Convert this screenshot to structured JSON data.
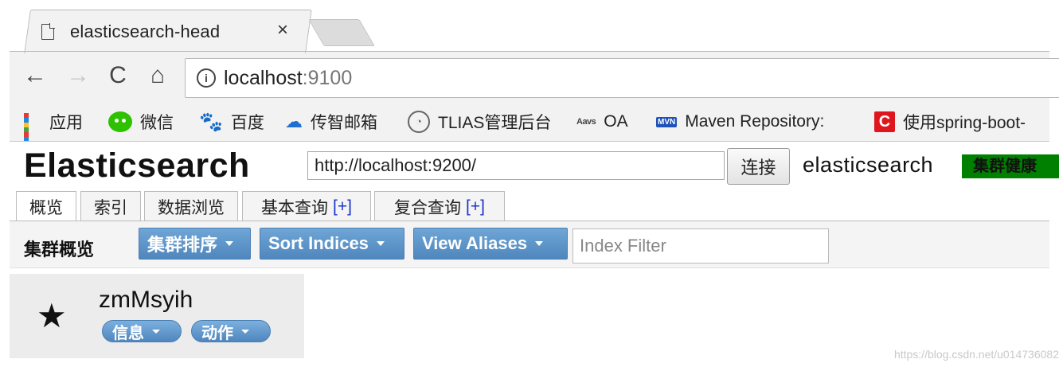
{
  "browser": {
    "tab_title": "elasticsearch-head",
    "tab_close": "×",
    "address": {
      "host": "localhost",
      "port": ":9100",
      "info_icon": "i"
    },
    "nav": {
      "back": "←",
      "forward": "→",
      "reload": "C",
      "home": "⌂"
    },
    "bookmarks": [
      {
        "label": "应用",
        "icon": "apps-grid-icon"
      },
      {
        "label": "微信",
        "icon": "wechat-icon"
      },
      {
        "label": "百度",
        "icon": "baidu-paw-icon",
        "glyph": "🐾"
      },
      {
        "label": "传智邮箱",
        "icon": "mail-wave-icon",
        "glyph": "☁"
      },
      {
        "label": "TLIAS管理后台",
        "icon": "tlias-icon",
        "glyph": "◔"
      },
      {
        "label": "OA",
        "icon": "oa-icon",
        "glyph": "Aavs"
      },
      {
        "label": "Maven Repository:",
        "icon": "mvn-icon",
        "glyph": "MVN"
      },
      {
        "label": "使用spring-boot-",
        "icon": "c-logo-icon",
        "glyph": "C"
      }
    ]
  },
  "es_head": {
    "logo": "Elasticsearch",
    "url_value": "http://localhost:9200/",
    "connect_label": "连接",
    "cluster_name": "elasticsearch",
    "health_label": "集群健康",
    "health_color": "#008000",
    "tabs": [
      {
        "label": "概览",
        "plus": ""
      },
      {
        "label": "索引",
        "plus": ""
      },
      {
        "label": "数据浏览",
        "plus": ""
      },
      {
        "label": "基本查询",
        "plus": "[+]"
      },
      {
        "label": "复合查询",
        "plus": "[+]"
      }
    ],
    "toolbar": {
      "title": "集群概览",
      "cluster_sort_label": "集群排序",
      "sort_indices_label": "Sort Indices",
      "view_aliases_label": "View Aliases",
      "filter_placeholder": "Index Filter"
    },
    "node": {
      "name": "zmMsyih",
      "star": "★",
      "info_label": "信息",
      "action_label": "动作"
    }
  },
  "watermark": "https://blog.csdn.net/u014736082"
}
